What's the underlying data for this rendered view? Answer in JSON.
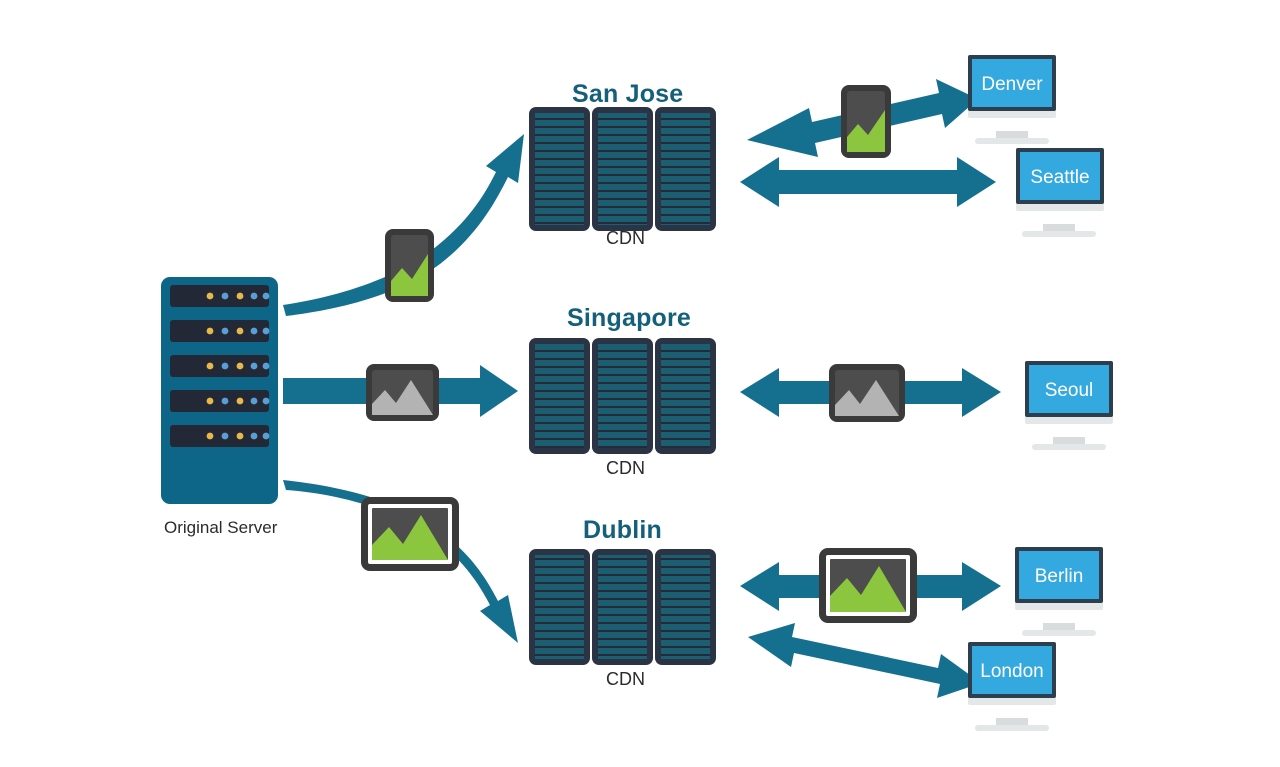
{
  "diagram": {
    "title_colors": {
      "city_heading": "#14607a",
      "arrow_teal": "#15708f",
      "monitor_screen": "#34a9e0",
      "monitor_bezel": "#2d3f4e",
      "monitor_stand": "#d8dcdd",
      "server_body": "#0d6687",
      "server_slot": "#232836",
      "led_orange": "#e8b84a",
      "led_blue": "#5b9ed6",
      "rack_border": "#2b3444",
      "rack_stripe": "#1c5f72",
      "image_icon_dark": "#4d4d4d",
      "image_icon_green": "#8cc63e",
      "image_icon_gray": "#b3b3b3",
      "image_icon_frame": "#3a3a3a"
    },
    "origin": {
      "name": "Original Server",
      "label": "Original Server",
      "led_pattern": [
        "orange",
        "blue",
        "orange",
        "blue",
        "blue"
      ],
      "slot_count": 5
    },
    "cdn_nodes": [
      {
        "id": "san-jose",
        "title": "San Jose",
        "caption": "CDN",
        "panels": 3,
        "stripes": 17
      },
      {
        "id": "singapore",
        "title": "Singapore",
        "caption": "CDN",
        "panels": 3,
        "stripes": 17
      },
      {
        "id": "dublin",
        "title": "Dublin",
        "caption": "CDN",
        "panels": 3,
        "stripes": 17
      }
    ],
    "clients": [
      {
        "id": "denver",
        "label": "Denver",
        "row": "san-jose"
      },
      {
        "id": "seattle",
        "label": "Seattle",
        "row": "san-jose"
      },
      {
        "id": "seoul",
        "label": "Seoul",
        "row": "singapore"
      },
      {
        "id": "berlin",
        "label": "Berlin",
        "row": "dublin"
      },
      {
        "id": "london",
        "label": "London",
        "row": "dublin"
      }
    ],
    "media_icons": [
      {
        "id": "origin-to-san-jose",
        "style": "portrait-green",
        "icon": "image-icon"
      },
      {
        "id": "origin-to-singapore",
        "style": "landscape-gray",
        "icon": "image-icon"
      },
      {
        "id": "origin-to-dublin",
        "style": "landscape-green-large",
        "icon": "image-icon"
      },
      {
        "id": "san-jose-to-denver",
        "style": "portrait-green",
        "icon": "image-icon"
      },
      {
        "id": "singapore-to-seoul",
        "style": "landscape-gray",
        "icon": "image-icon"
      },
      {
        "id": "dublin-to-berlin",
        "style": "landscape-green-large",
        "icon": "image-icon"
      }
    ],
    "connections": [
      {
        "from": "Original Server",
        "to": "San Jose",
        "kind": "curved-up"
      },
      {
        "from": "Original Server",
        "to": "Singapore",
        "kind": "straight"
      },
      {
        "from": "Original Server",
        "to": "Dublin",
        "kind": "curved-down"
      },
      {
        "from": "San Jose",
        "to": "Denver",
        "kind": "double-arrow-diagonal"
      },
      {
        "from": "San Jose",
        "to": "Seattle",
        "kind": "double-arrow"
      },
      {
        "from": "Singapore",
        "to": "Seoul",
        "kind": "double-arrow"
      },
      {
        "from": "Dublin",
        "to": "Berlin",
        "kind": "double-arrow"
      },
      {
        "from": "Dublin",
        "to": "London",
        "kind": "double-arrow-diagonal"
      }
    ]
  }
}
